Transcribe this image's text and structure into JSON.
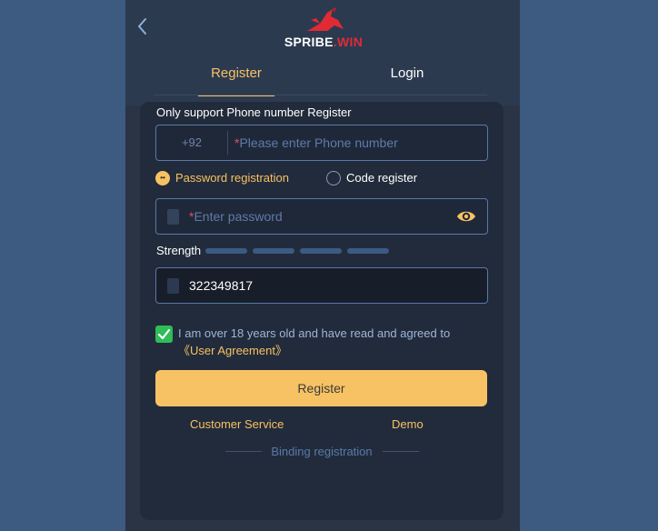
{
  "header": {
    "back_icon": "chevron-left-icon",
    "logo": {
      "brand": "SPRIBE",
      "suffix": "WIN"
    }
  },
  "tabs": [
    {
      "label": "Register",
      "active": true
    },
    {
      "label": "Login",
      "active": false
    }
  ],
  "form": {
    "section_label": "Only support Phone number Register",
    "phone": {
      "country_code": "+92",
      "required_mark": "*",
      "placeholder": "Please enter Phone number"
    },
    "mode": [
      {
        "label": "Password registration",
        "selected": true
      },
      {
        "label": "Code register",
        "selected": false
      }
    ],
    "password": {
      "required_mark": "*",
      "placeholder": "Enter password",
      "toggle_icon": "eye-icon"
    },
    "strength": {
      "label": "Strength",
      "level": 0,
      "segments": 4
    },
    "captcha": {
      "value": "322349817"
    },
    "agreement": {
      "checked": true,
      "text": "I am over 18 years old and have read and agreed to ",
      "link": "《User Agreement》"
    },
    "submit_label": "Register"
  },
  "footer": {
    "customer_service": "Customer Service",
    "demo": "Demo",
    "binding": "Binding registration"
  },
  "colors": {
    "accent": "#f7c263",
    "background": "#3d5a80",
    "panel": "#222b3b",
    "check": "#2ebd59",
    "brand_red": "#e02b35"
  }
}
